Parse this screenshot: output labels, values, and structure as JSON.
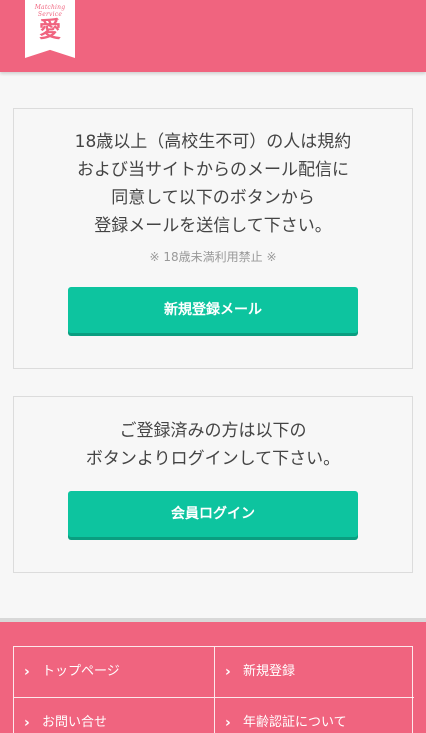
{
  "header": {
    "logo_sub": "Matching Service",
    "logo_kanji": "愛",
    "color": "#f0647f"
  },
  "register": {
    "lines": [
      "18歳以上（高校生不可）の人は規約",
      "および当サイトからのメール配信に",
      "同意して以下のボタンから",
      "登録メールを送信して下さい。"
    ],
    "note": "※ 18歳未満利用禁止 ※",
    "button_label": "新規登録メール"
  },
  "login": {
    "lines": [
      "ご登録済みの方は以下の",
      "ボタンよりログインして下さい。"
    ],
    "button_label": "会員ログイン"
  },
  "footer": {
    "chevron": "›",
    "links": [
      "トップページ",
      "新規登録",
      "お問い合せ",
      "年齢認証について"
    ]
  },
  "colors": {
    "accent": "#f0647f",
    "button": "#0dc49f"
  }
}
